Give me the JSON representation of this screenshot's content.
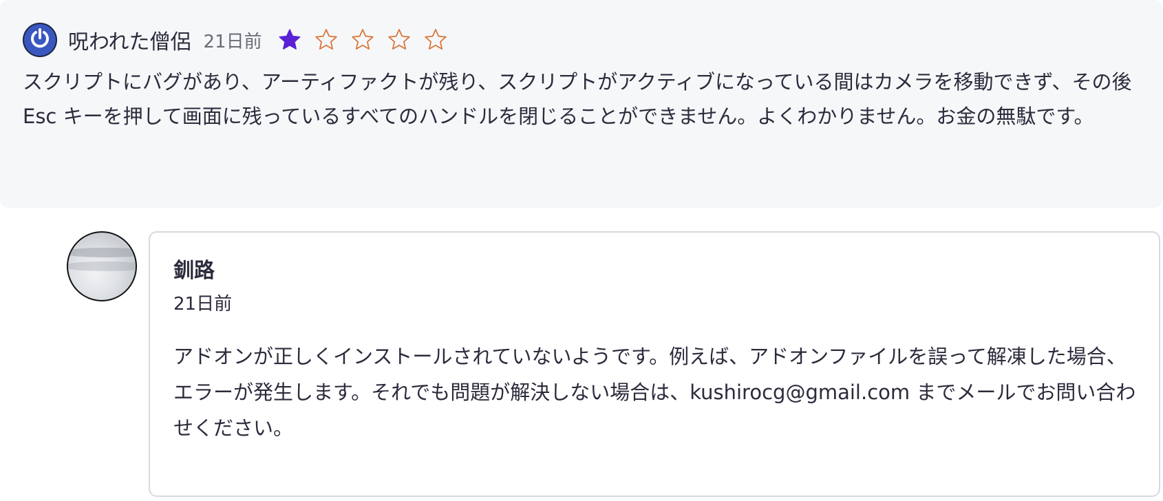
{
  "review": {
    "reviewer_name": "呪われた僧侶",
    "time": "21日前",
    "avatar_icon": "power-icon",
    "rating": 1,
    "rating_max": 5,
    "star_filled_color": "#5b21d6",
    "star_empty_color": "#d9773c",
    "body": "スクリプトにバグがあり、アーティファクトが残り、スクリプトがアクティブになっている間はカメラを移動できず、その後 Esc キーを押して画面に残っているすべてのハンドルを閉じることができません。よくわかりません。お金の無駄です。"
  },
  "reply": {
    "author_name": "釧路",
    "time": "21日前",
    "body": "アドオンが正しくインストールされていないようです。例えば、アドオンファイルを誤って解凍した場合、エラーが発生します。それでも問題が解決しない場合は、kushirocg@gmail.com までメールでお問い合わせください。"
  }
}
